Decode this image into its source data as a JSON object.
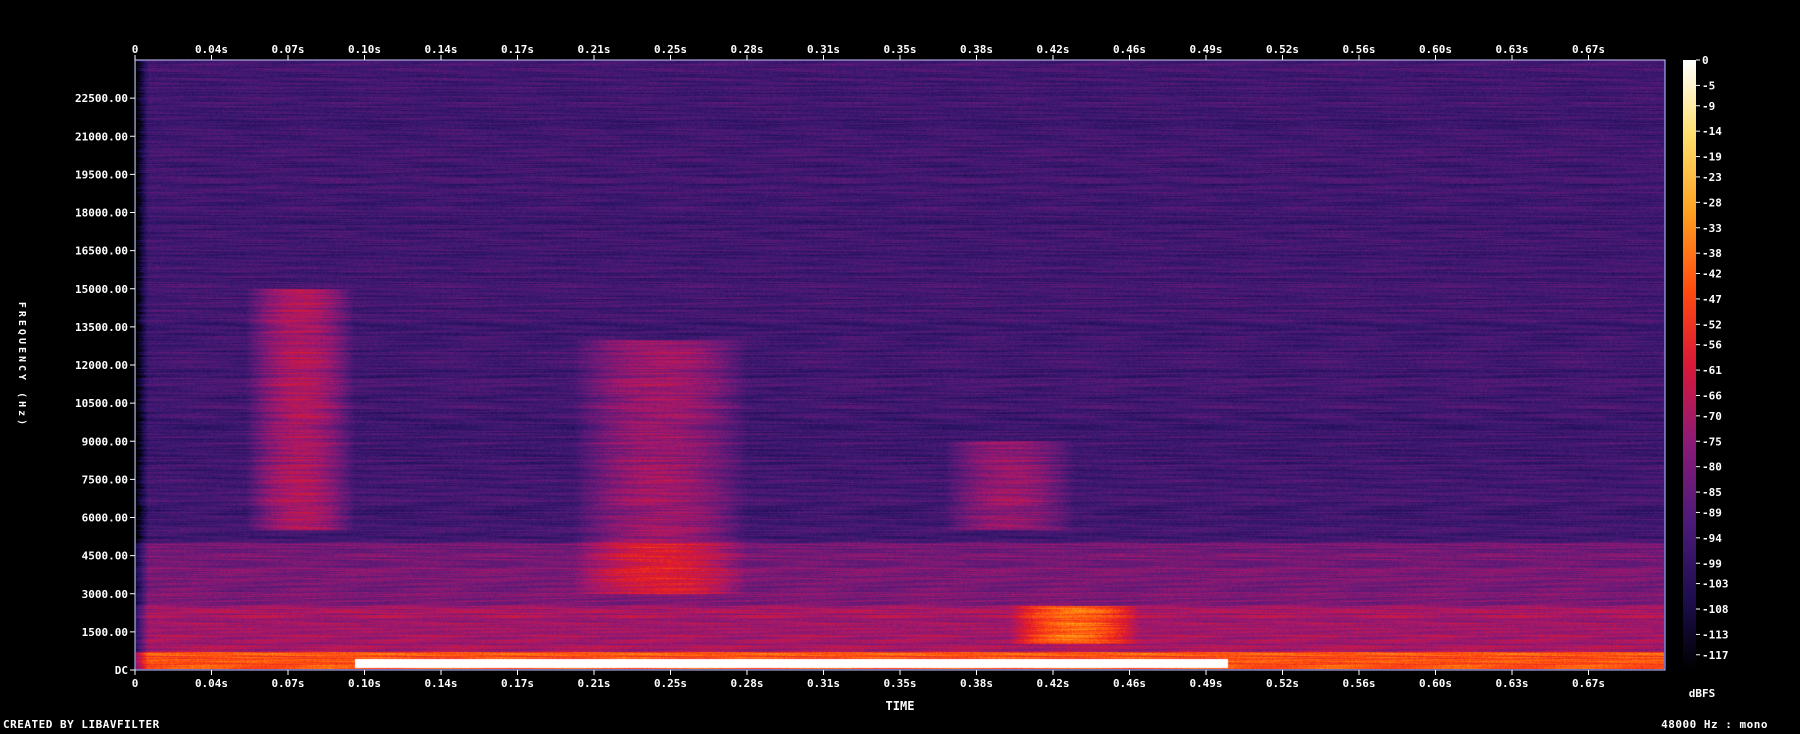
{
  "footer": {
    "credit": "CREATED BY LIBAVFILTER",
    "sample_rate": "48000 Hz : mono"
  },
  "chart_data": {
    "type": "heatmap",
    "title": "",
    "xlabel": "TIME",
    "ylabel": "FREQUENCY (Hz)",
    "colorbar_label": "dBFS",
    "x_ticks": [
      "0",
      "0.04s",
      "0.07s",
      "0.10s",
      "0.14s",
      "0.17s",
      "0.21s",
      "0.25s",
      "0.28s",
      "0.31s",
      "0.35s",
      "0.38s",
      "0.42s",
      "0.46s",
      "0.49s",
      "0.52s",
      "0.56s",
      "0.60s",
      "0.63s",
      "0.67s"
    ],
    "y_ticks": [
      "DC",
      "1500.00",
      "3000.00",
      "4500.00",
      "6000.00",
      "7500.00",
      "9000.00",
      "10500.00",
      "12000.00",
      "13500.00",
      "15000.00",
      "16500.00",
      "18000.00",
      "19500.00",
      "21000.00",
      "22500.00"
    ],
    "xlim": [
      0,
      0.7
    ],
    "ylim": [
      0,
      24000
    ],
    "colorbar_ticks": [
      "0",
      "-5",
      "-9",
      "-14",
      "-19",
      "-23",
      "-28",
      "-33",
      "-38",
      "-42",
      "-47",
      "-52",
      "-56",
      "-61",
      "-66",
      "-70",
      "-75",
      "-80",
      "-85",
      "-89",
      "-94",
      "-99",
      "-103",
      "-108",
      "-113",
      "-117"
    ],
    "colorbar_range": [
      -120,
      0
    ],
    "colormap": [
      "#000000",
      "#1a0c50",
      "#3a1870",
      "#6a1a78",
      "#a8186a",
      "#e01a2a",
      "#ff4a10",
      "#ff9a10",
      "#ffd830",
      "#ffffff"
    ],
    "background_level_db": -92,
    "features": [
      {
        "kind": "band",
        "t": [
          0.0,
          0.7
        ],
        "f": [
          0,
          700
        ],
        "level_db": -35
      },
      {
        "kind": "band",
        "t": [
          0.0,
          0.7
        ],
        "f": [
          700,
          2500
        ],
        "level_db": -65
      },
      {
        "kind": "band",
        "t": [
          0.0,
          0.7
        ],
        "f": [
          2500,
          5000
        ],
        "level_db": -75
      },
      {
        "kind": "band",
        "t": [
          0.1,
          0.5
        ],
        "f": [
          50,
          400
        ],
        "level_db": -25
      },
      {
        "kind": "burst",
        "t": [
          0.05,
          0.1
        ],
        "f": [
          5500,
          15000
        ],
        "level_db": -62
      },
      {
        "kind": "burst",
        "t": [
          0.2,
          0.28
        ],
        "f": [
          3000,
          13000
        ],
        "level_db": -66
      },
      {
        "kind": "burst",
        "t": [
          0.37,
          0.43
        ],
        "f": [
          5500,
          9000
        ],
        "level_db": -68
      },
      {
        "kind": "burst",
        "t": [
          0.4,
          0.46
        ],
        "f": [
          1000,
          2500
        ],
        "level_db": -55
      }
    ]
  }
}
